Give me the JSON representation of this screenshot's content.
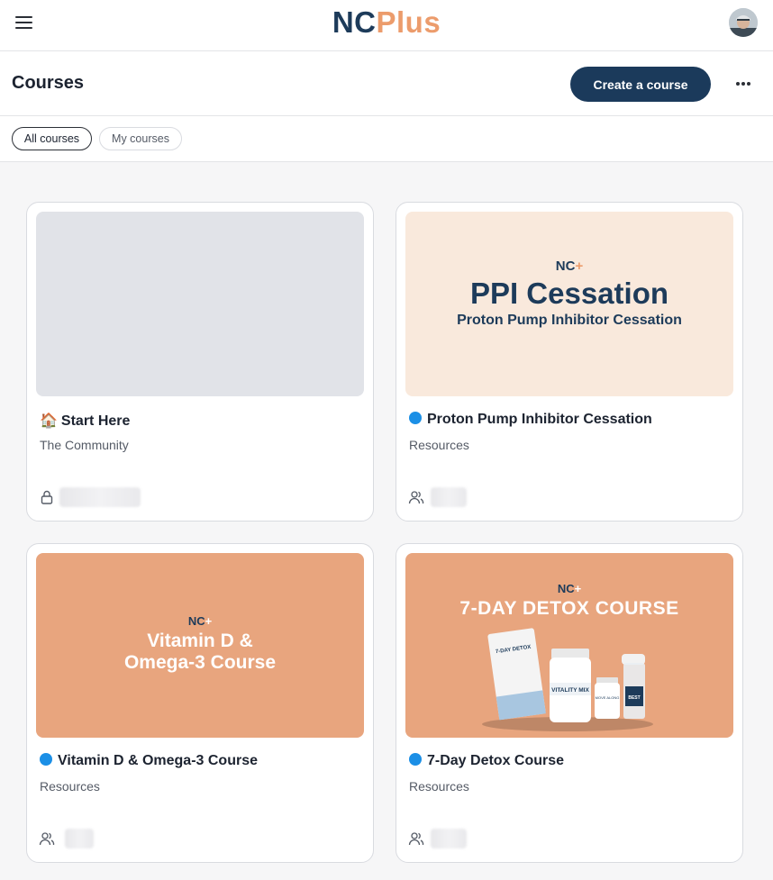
{
  "app": {
    "logo_nc": "NC",
    "logo_plus": "Plus"
  },
  "header": {
    "title": "Courses",
    "create_label": "Create a course"
  },
  "filters": {
    "all": "All courses",
    "mine": "My courses"
  },
  "courses": [
    {
      "title": "Start Here",
      "emoji": "🏠",
      "subtitle": "The Community",
      "status": "locked"
    },
    {
      "title": "Proton Pump Inhibitor Cessation",
      "subtitle": "Resources",
      "status": "members",
      "thumb": {
        "brand": "NC",
        "heading": "PPI Cessation",
        "subheading": "Proton Pump Inhibitor Cessation"
      }
    },
    {
      "title": "Vitamin D & Omega-3 Course",
      "subtitle": "Resources",
      "status": "members",
      "thumb": {
        "brand": "NC",
        "line1": "Vitamin D &",
        "line2": "Omega-3 Course"
      }
    },
    {
      "title": "7-Day Detox Course",
      "subtitle": "Resources",
      "status": "members",
      "thumb": {
        "brand": "NC",
        "heading": "7-DAY DETOX COURSE",
        "box_label": "7-DAY DETOX",
        "jar_label": "VITALITY MIX",
        "small_label": "MOVE ALONG",
        "shaker_label": "BEST"
      }
    }
  ],
  "colors": {
    "brand_navy": "#1b3a5b",
    "brand_peach": "#ec9c6c",
    "thumb_peach_light": "#f9e9dc",
    "thumb_peach": "#e8a57e",
    "dot_blue": "#1b8fe6"
  }
}
